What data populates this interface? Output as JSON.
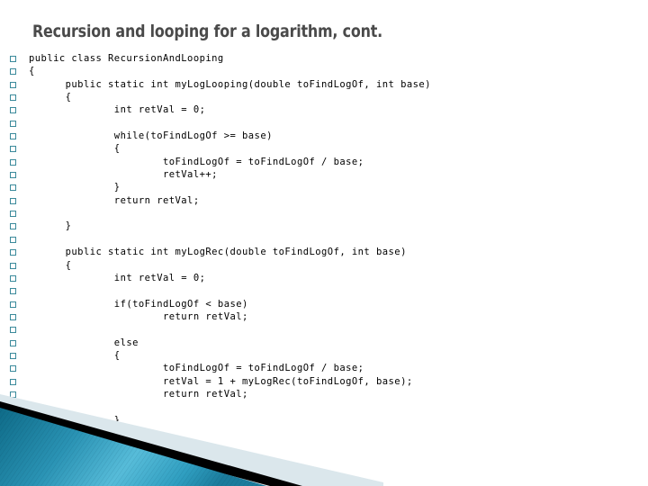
{
  "slide": {
    "title": "Recursion and looping for a logarithm, cont.",
    "accent_teal_dark": "#12718f",
    "accent_teal_light": "#57bcd9",
    "accent_pale": "#dbe7ec",
    "bullet_color": "#3b8a9b",
    "title_color": "#4a4a4a",
    "code_color": "#000000",
    "background": "#ffffff"
  },
  "code": {
    "language": "java",
    "lines": [
      "public class RecursionAndLooping",
      "{",
      "      public static int myLogLooping(double toFindLogOf, int base)",
      "      {",
      "              int retVal = 0;",
      "",
      "              while(toFindLogOf >= base)",
      "              {",
      "                      toFindLogOf = toFindLogOf / base;",
      "                      retVal++;",
      "              }",
      "              return retVal;",
      "",
      "      }",
      "",
      "      public static int myLogRec(double toFindLogOf, int base)",
      "      {",
      "              int retVal = 0;",
      "",
      "              if(toFindLogOf < base)",
      "                      return retVal;",
      "",
      "              else",
      "              {",
      "                      toFindLogOf = toFindLogOf / base;",
      "                      retVal = 1 + myLogRec(toFindLogOf, base);",
      "                      return retVal;",
      "",
      "              }",
      "      }",
      "}"
    ]
  }
}
